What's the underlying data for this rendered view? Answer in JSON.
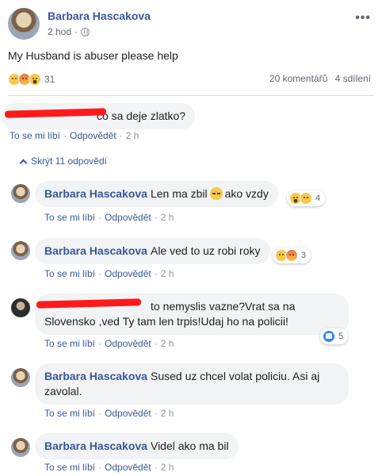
{
  "post": {
    "author": "Barbara Hascakova",
    "time": "2 hod",
    "dot": "·",
    "text": "My Husband is abuser please help",
    "reaction_count": "31",
    "comments_count": "20 komentářů",
    "shares_count": "4 sdílení",
    "reactions": [
      "sad",
      "angry",
      "wow"
    ]
  },
  "actions": {
    "like": "To se mi líbí",
    "reply": "Odpovědět",
    "dot": "·"
  },
  "hide_replies": "Skrýt 11 odpovědí",
  "comments": [
    {
      "author": "",
      "text": "co sa deje zlatko?",
      "time": "2 h",
      "redacted": true
    },
    {
      "author": "Barbara Hascakova",
      "text": "Len ma zbil",
      "text_after": "ako vzdy",
      "time": "2 h",
      "reaction_count": "4",
      "reactions": [
        "wow",
        "sad"
      ]
    },
    {
      "author": "Barbara Hascakova",
      "text": "Ale ved to uz robi roky",
      "time": "2 h",
      "reaction_count": "3",
      "reactions": [
        "sad",
        "angry"
      ]
    },
    {
      "author": "",
      "text_line1": "to nemyslis vazne?Vrat sa na",
      "text_line2": "Slovensko ,ved Ty tam len trpis!Udaj ho na policii!",
      "time": "2 h",
      "reaction_count": "5",
      "reactions": [
        "like"
      ],
      "redacted": true
    },
    {
      "author": "Barbara Hascakova",
      "text_line1": "Sused uz chcel volat policiu. Asi aj",
      "text_line2": "zavolal.",
      "time": "2 h"
    },
    {
      "author": "Barbara Hascakova",
      "text": "Videl ako ma bil",
      "time": "2 h"
    }
  ],
  "colors": {
    "link": "#385898",
    "redaction": "#ff1a1a",
    "bubble": "#f2f3f5"
  }
}
